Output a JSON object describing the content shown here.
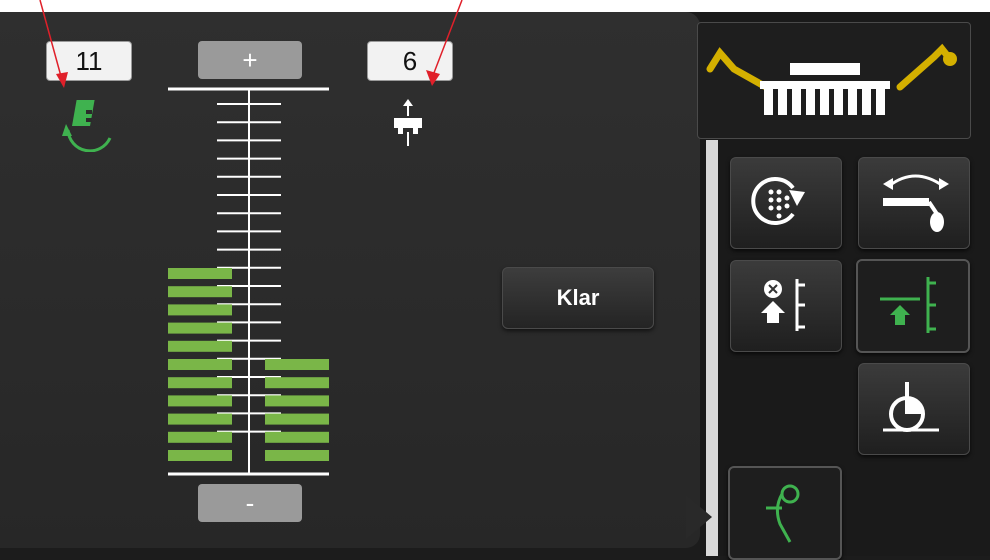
{
  "left_value": "11",
  "right_value": "6",
  "plus_label": "+",
  "minus_label": "-",
  "klar_label": "Klar",
  "scale": {
    "ticks_total": 19,
    "left_bar_segments": 11,
    "right_bar_segments": 6
  },
  "icons": {
    "left_indicator": "rotation-icon",
    "right_indicator": "lift-icon",
    "machine_overview": "machine-overview-icon",
    "rotate_dots": "rotate-dots-icon",
    "swing": "swing-icon",
    "stop_lift": "stop-lift-icon",
    "lift_active": "lift-active-icon",
    "disc": "disc-icon",
    "hook": "hook-icon"
  },
  "colors": {
    "green": "#7ab648",
    "icon_green": "#3fb24f",
    "annotation_red": "#e0202a",
    "value_box": "#f2f2f2",
    "button_gray": "#9a9a9a"
  }
}
